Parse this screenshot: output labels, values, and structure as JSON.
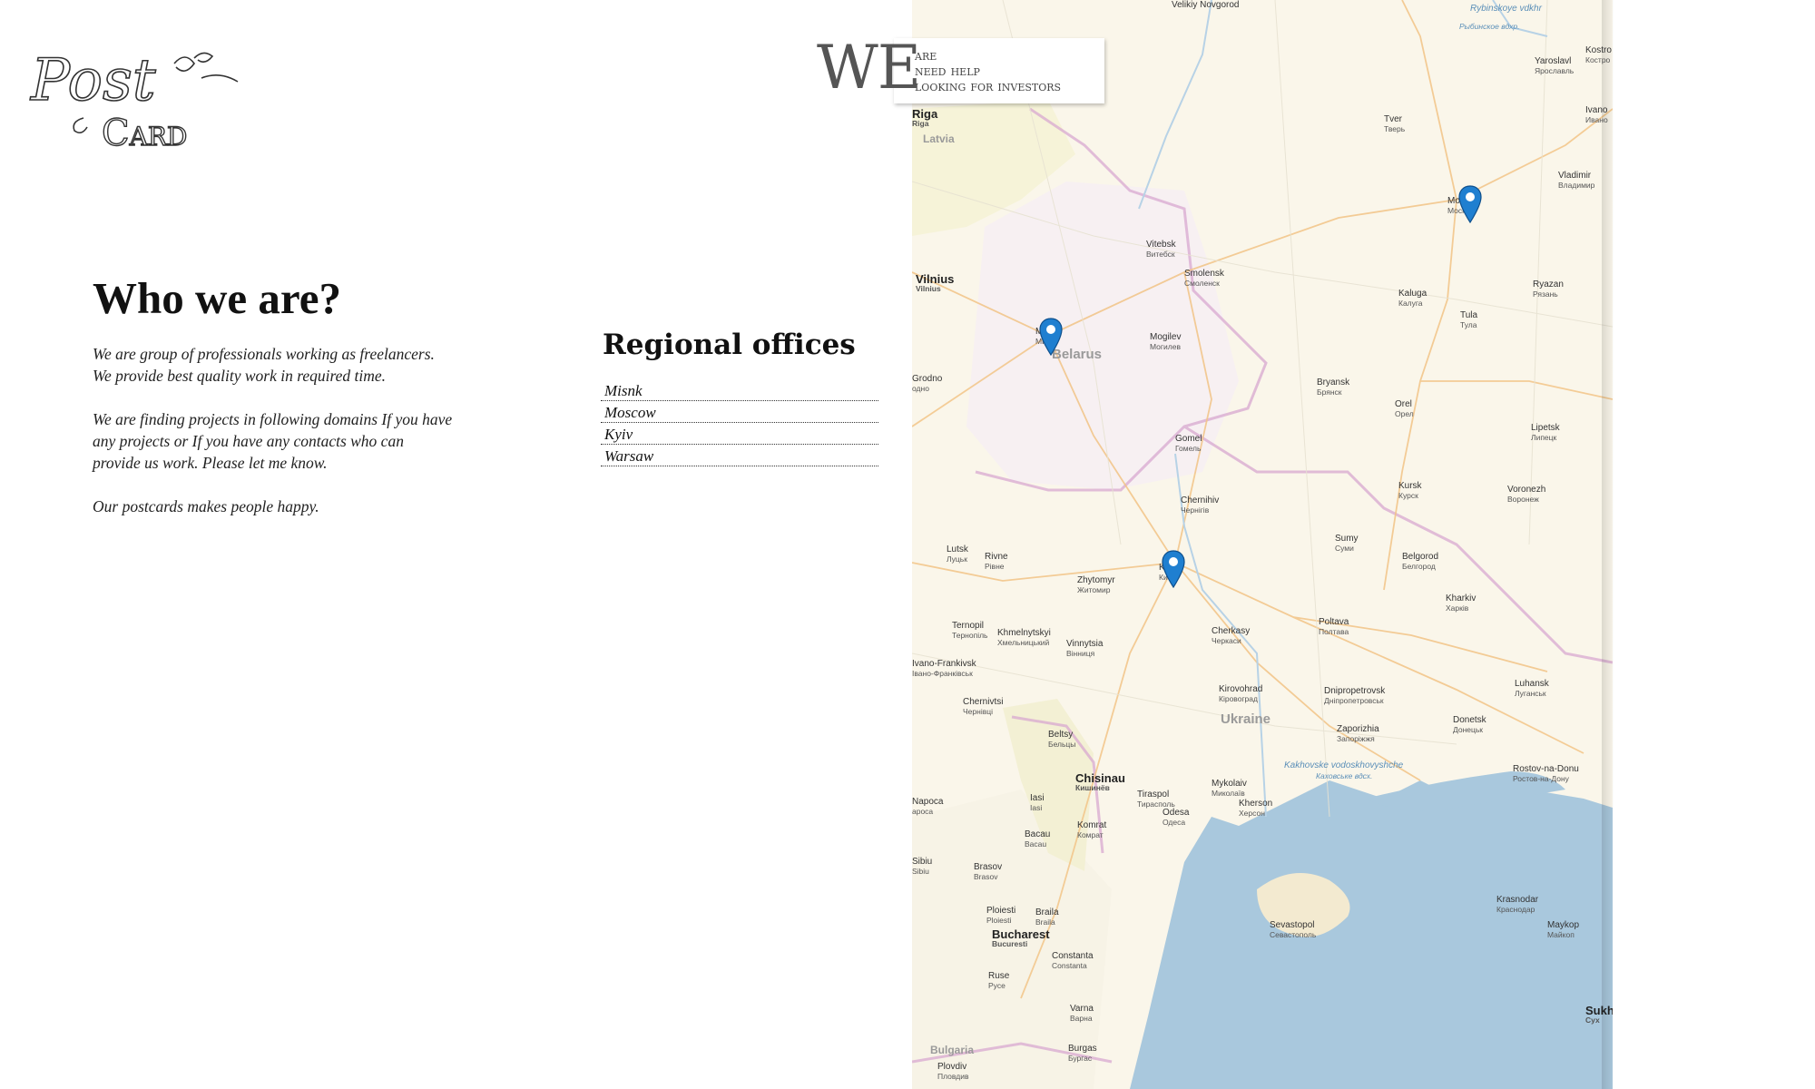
{
  "logo": {
    "line1": "Post",
    "line2": "Card"
  },
  "banner": {
    "we": "WE",
    "lines": [
      "are",
      "need help",
      "looking for investors"
    ]
  },
  "about": {
    "title": "Who we are?",
    "paragraphs": [
      "We are group of professionals working as freelancers. We provide best quality work in required time.",
      "We are finding projects in following domains If you have any projects or If you have any contacts who can provide us work. Please let me know.",
      "Our postcards makes people happy."
    ]
  },
  "offices": {
    "title": "Regional offices",
    "items": [
      "Misnk",
      "Moscow",
      "Kyiv",
      "Warsaw"
    ]
  },
  "map": {
    "countries": [
      "Latvia",
      "Belarus",
      "Ukraine",
      "Bulgaria"
    ],
    "water": [
      "Rybinskoye vdkhr",
      "Рыбинское вдхр.",
      "Kakhovske vodoskhovyshche",
      "Каховське вдсх."
    ],
    "cities": [
      {
        "en": "Velikiy Novgorod",
        "ru": ""
      },
      {
        "en": "Riga",
        "ru": "Riga"
      },
      {
        "en": "Yaroslavl",
        "ru": "Ярославль"
      },
      {
        "en": "Kostro",
        "ru": "Костро"
      },
      {
        "en": "Ivano",
        "ru": "Ивано"
      },
      {
        "en": "Tver",
        "ru": "Тверь"
      },
      {
        "en": "Vladimir",
        "ru": "Владимир"
      },
      {
        "en": "Moscow",
        "ru": "Москва"
      },
      {
        "en": "Vitebsk",
        "ru": "Витебск"
      },
      {
        "en": "Smolensk",
        "ru": "Смоленск"
      },
      {
        "en": "Vilnius",
        "ru": "Vilnius"
      },
      {
        "en": "Kaluga",
        "ru": "Калуга"
      },
      {
        "en": "Ryazan",
        "ru": "Рязань"
      },
      {
        "en": "Tula",
        "ru": "Тула"
      },
      {
        "en": "Minsk",
        "ru": "Минск"
      },
      {
        "en": "Mogilev",
        "ru": "Могилев"
      },
      {
        "en": "Bryansk",
        "ru": "Брянск"
      },
      {
        "en": "Orel",
        "ru": "Орел"
      },
      {
        "en": "Lipetsk",
        "ru": "Липецк"
      },
      {
        "en": "Gomel",
        "ru": "Гомель"
      },
      {
        "en": "Kursk",
        "ru": "Курск"
      },
      {
        "en": "Voronezh",
        "ru": "Воронеж"
      },
      {
        "en": "Chernihiv",
        "ru": "Чернігів"
      },
      {
        "en": "Sumy",
        "ru": "Суми"
      },
      {
        "en": "Lutsk",
        "ru": "Луцьк"
      },
      {
        "en": "Rivne",
        "ru": "Рівне"
      },
      {
        "en": "Belgorod",
        "ru": "Белгород"
      },
      {
        "en": "Zhytomyr",
        "ru": "Житомир"
      },
      {
        "en": "Kyiv",
        "ru": "Київ"
      },
      {
        "en": "Kharkiv",
        "ru": "Харків"
      },
      {
        "en": "Ternopil",
        "ru": "Тернопіль"
      },
      {
        "en": "Khmelnytskyi",
        "ru": "Хмельницький"
      },
      {
        "en": "Cherkasy",
        "ru": "Черкаси"
      },
      {
        "en": "Poltava",
        "ru": "Полтава"
      },
      {
        "en": "Vinnytsia",
        "ru": "Вінниця"
      },
      {
        "en": "Ivano-Frankivsk",
        "ru": "Івано-Франківськ"
      },
      {
        "en": "Kirovohrad",
        "ru": "Кіровоград"
      },
      {
        "en": "Dnipropetrovsk",
        "ru": "Дніпропетровськ"
      },
      {
        "en": "Luhansk",
        "ru": "Луганськ"
      },
      {
        "en": "Chernivtsi",
        "ru": "Чернівці"
      },
      {
        "en": "Zaporizhia",
        "ru": "Запоріжжя"
      },
      {
        "en": "Donetsk",
        "ru": "Донецьк"
      },
      {
        "en": "Beltsy",
        "ru": "Бельцы"
      },
      {
        "en": "Chisinau",
        "ru": "Кишинёв"
      },
      {
        "en": "Tiraspol",
        "ru": "Тирасполь"
      },
      {
        "en": "Mykolaiv",
        "ru": "Миколаїв"
      },
      {
        "en": "Rostov-na-Donu",
        "ru": "Ростов-на-Дону"
      },
      {
        "en": "Iasi",
        "ru": "Iasi"
      },
      {
        "en": "Odesa",
        "ru": "Одеса"
      },
      {
        "en": "Kherson",
        "ru": "Херсон"
      },
      {
        "en": "Komrat",
        "ru": "Комрат"
      },
      {
        "en": "Bacau",
        "ru": "Bacau"
      },
      {
        "en": "Brasov",
        "ru": "Brasov"
      },
      {
        "en": "Krasnodar",
        "ru": "Краснодар"
      },
      {
        "en": "Ploiesti",
        "ru": "Ploiesti"
      },
      {
        "en": "Braila",
        "ru": "Braila"
      },
      {
        "en": "Sevastopol",
        "ru": "Севастополь"
      },
      {
        "en": "Maykop",
        "ru": "Майкоп"
      },
      {
        "en": "Bucharest",
        "ru": "Bucuresti"
      },
      {
        "en": "Constanta",
        "ru": "Constanta"
      },
      {
        "en": "Ruse",
        "ru": "Русе"
      },
      {
        "en": "Varna",
        "ru": "Варна"
      },
      {
        "en": "Burgas",
        "ru": "Бургас"
      },
      {
        "en": "Plovdiv",
        "ru": "Пловдив"
      },
      {
        "en": "Sukh",
        "ru": "Сух"
      },
      {
        "en": "Napoca",
        "ru": "apoca"
      },
      {
        "en": "Sibiu",
        "ru": "Sibiu"
      },
      {
        "en": "Grodno",
        "ru": "одно"
      }
    ]
  },
  "colors": {
    "land": "#faf6ea",
    "sea": "#a9c8dd",
    "road": "#f2c487",
    "border": "#d8a8d0",
    "pin": "#1f7fd0"
  }
}
